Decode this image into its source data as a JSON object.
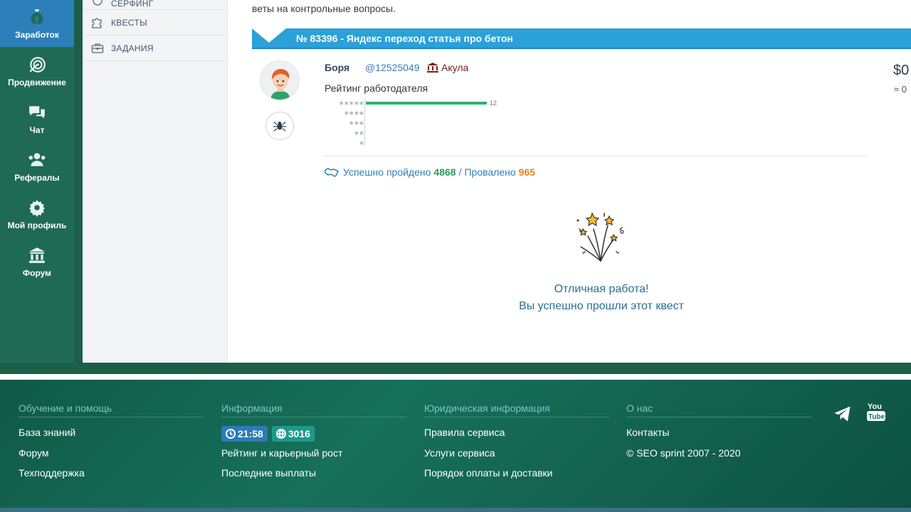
{
  "leftnav": {
    "items": [
      {
        "label": "Заработок",
        "icon": "money-bag-icon",
        "active": true
      },
      {
        "label": "Продвижение",
        "icon": "target-arrow-icon"
      },
      {
        "label": "Чат",
        "icon": "chat-icon"
      },
      {
        "label": "Рефералы",
        "icon": "users-icon"
      },
      {
        "label": "Мой профиль",
        "icon": "gear-icon"
      },
      {
        "label": "Форум",
        "icon": "building-icon"
      }
    ]
  },
  "subnav": {
    "items": [
      {
        "label": "СЕРФИНГ",
        "icon": "surfing-icon"
      },
      {
        "label": "КВЕСТЫ",
        "icon": "puzzle-icon"
      },
      {
        "label": "ЗАДАНИЯ",
        "icon": "briefcase-icon"
      }
    ]
  },
  "main": {
    "intro_text": "веты на контрольные вопросы.",
    "quest_title": "№ 83396 - Яндекс переход статья про бетон",
    "user": {
      "name": "Боря",
      "id": "@12525049",
      "rank": "Акула"
    },
    "price": "$0",
    "price_sub": "≈ 0",
    "rating_label": "Рейтинг работодателя",
    "rating": [
      {
        "stars": "★★★★★",
        "value": 12
      },
      {
        "stars": "★★★★",
        "value": 0
      },
      {
        "stars": "★★★",
        "value": 0
      },
      {
        "stars": "★★",
        "value": 0
      },
      {
        "stars": "★",
        "value": 0
      }
    ],
    "rating_max": 12,
    "rating_value_label": "12",
    "stats": {
      "passed_label": "Успешно пройдено",
      "passed_value": "4868",
      "separator": "/",
      "failed_label": "Провалено",
      "failed_value": "965"
    },
    "done_line1": "Отличная работа!",
    "done_line2": "Вы успешно прошли этот квест"
  },
  "footer": {
    "columns": [
      {
        "title": "Обучение и помощь",
        "links": [
          "База знаний",
          "Форум",
          "Техподдержка"
        ]
      },
      {
        "title": "Информация",
        "links": [
          "Рейтинг и карьерный рост",
          "Последние выплаты"
        ]
      },
      {
        "title": "Юридическая информация",
        "links": [
          "Правила сервиса",
          "Услуги сервиса",
          "Порядок оплаты и доставки"
        ]
      },
      {
        "title": "О нас",
        "links": [
          "Контакты",
          "© SEO sprint 2007 - 2020"
        ]
      }
    ],
    "time_pill": "21:58",
    "count_pill": "3016",
    "social": [
      "telegram-icon",
      "youtube-icon"
    ]
  },
  "colors": {
    "nav_bg": "#1f6a55",
    "nav_active": "#2c7fb8",
    "quest_bar": "#2aa1d8",
    "success": "#2a9d59",
    "fail": "#e67e22"
  }
}
